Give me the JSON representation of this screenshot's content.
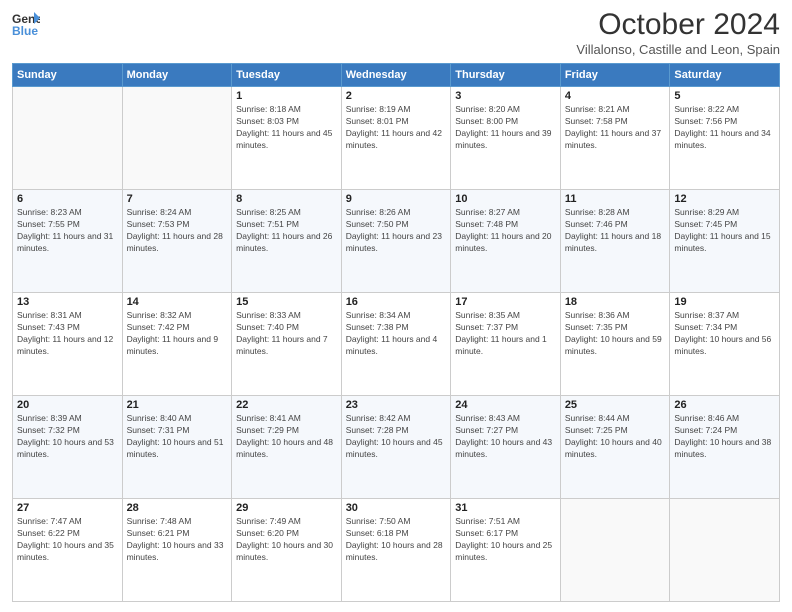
{
  "header": {
    "logo_line1": "General",
    "logo_line2": "Blue",
    "month_year": "October 2024",
    "location": "Villalonso, Castille and Leon, Spain"
  },
  "days_of_week": [
    "Sunday",
    "Monday",
    "Tuesday",
    "Wednesday",
    "Thursday",
    "Friday",
    "Saturday"
  ],
  "weeks": [
    [
      {
        "day": "",
        "sunrise": "",
        "sunset": "",
        "daylight": ""
      },
      {
        "day": "",
        "sunrise": "",
        "sunset": "",
        "daylight": ""
      },
      {
        "day": "1",
        "sunrise": "Sunrise: 8:18 AM",
        "sunset": "Sunset: 8:03 PM",
        "daylight": "Daylight: 11 hours and 45 minutes."
      },
      {
        "day": "2",
        "sunrise": "Sunrise: 8:19 AM",
        "sunset": "Sunset: 8:01 PM",
        "daylight": "Daylight: 11 hours and 42 minutes."
      },
      {
        "day": "3",
        "sunrise": "Sunrise: 8:20 AM",
        "sunset": "Sunset: 8:00 PM",
        "daylight": "Daylight: 11 hours and 39 minutes."
      },
      {
        "day": "4",
        "sunrise": "Sunrise: 8:21 AM",
        "sunset": "Sunset: 7:58 PM",
        "daylight": "Daylight: 11 hours and 37 minutes."
      },
      {
        "day": "5",
        "sunrise": "Sunrise: 8:22 AM",
        "sunset": "Sunset: 7:56 PM",
        "daylight": "Daylight: 11 hours and 34 minutes."
      }
    ],
    [
      {
        "day": "6",
        "sunrise": "Sunrise: 8:23 AM",
        "sunset": "Sunset: 7:55 PM",
        "daylight": "Daylight: 11 hours and 31 minutes."
      },
      {
        "day": "7",
        "sunrise": "Sunrise: 8:24 AM",
        "sunset": "Sunset: 7:53 PM",
        "daylight": "Daylight: 11 hours and 28 minutes."
      },
      {
        "day": "8",
        "sunrise": "Sunrise: 8:25 AM",
        "sunset": "Sunset: 7:51 PM",
        "daylight": "Daylight: 11 hours and 26 minutes."
      },
      {
        "day": "9",
        "sunrise": "Sunrise: 8:26 AM",
        "sunset": "Sunset: 7:50 PM",
        "daylight": "Daylight: 11 hours and 23 minutes."
      },
      {
        "day": "10",
        "sunrise": "Sunrise: 8:27 AM",
        "sunset": "Sunset: 7:48 PM",
        "daylight": "Daylight: 11 hours and 20 minutes."
      },
      {
        "day": "11",
        "sunrise": "Sunrise: 8:28 AM",
        "sunset": "Sunset: 7:46 PM",
        "daylight": "Daylight: 11 hours and 18 minutes."
      },
      {
        "day": "12",
        "sunrise": "Sunrise: 8:29 AM",
        "sunset": "Sunset: 7:45 PM",
        "daylight": "Daylight: 11 hours and 15 minutes."
      }
    ],
    [
      {
        "day": "13",
        "sunrise": "Sunrise: 8:31 AM",
        "sunset": "Sunset: 7:43 PM",
        "daylight": "Daylight: 11 hours and 12 minutes."
      },
      {
        "day": "14",
        "sunrise": "Sunrise: 8:32 AM",
        "sunset": "Sunset: 7:42 PM",
        "daylight": "Daylight: 11 hours and 9 minutes."
      },
      {
        "day": "15",
        "sunrise": "Sunrise: 8:33 AM",
        "sunset": "Sunset: 7:40 PM",
        "daylight": "Daylight: 11 hours and 7 minutes."
      },
      {
        "day": "16",
        "sunrise": "Sunrise: 8:34 AM",
        "sunset": "Sunset: 7:38 PM",
        "daylight": "Daylight: 11 hours and 4 minutes."
      },
      {
        "day": "17",
        "sunrise": "Sunrise: 8:35 AM",
        "sunset": "Sunset: 7:37 PM",
        "daylight": "Daylight: 11 hours and 1 minute."
      },
      {
        "day": "18",
        "sunrise": "Sunrise: 8:36 AM",
        "sunset": "Sunset: 7:35 PM",
        "daylight": "Daylight: 10 hours and 59 minutes."
      },
      {
        "day": "19",
        "sunrise": "Sunrise: 8:37 AM",
        "sunset": "Sunset: 7:34 PM",
        "daylight": "Daylight: 10 hours and 56 minutes."
      }
    ],
    [
      {
        "day": "20",
        "sunrise": "Sunrise: 8:39 AM",
        "sunset": "Sunset: 7:32 PM",
        "daylight": "Daylight: 10 hours and 53 minutes."
      },
      {
        "day": "21",
        "sunrise": "Sunrise: 8:40 AM",
        "sunset": "Sunset: 7:31 PM",
        "daylight": "Daylight: 10 hours and 51 minutes."
      },
      {
        "day": "22",
        "sunrise": "Sunrise: 8:41 AM",
        "sunset": "Sunset: 7:29 PM",
        "daylight": "Daylight: 10 hours and 48 minutes."
      },
      {
        "day": "23",
        "sunrise": "Sunrise: 8:42 AM",
        "sunset": "Sunset: 7:28 PM",
        "daylight": "Daylight: 10 hours and 45 minutes."
      },
      {
        "day": "24",
        "sunrise": "Sunrise: 8:43 AM",
        "sunset": "Sunset: 7:27 PM",
        "daylight": "Daylight: 10 hours and 43 minutes."
      },
      {
        "day": "25",
        "sunrise": "Sunrise: 8:44 AM",
        "sunset": "Sunset: 7:25 PM",
        "daylight": "Daylight: 10 hours and 40 minutes."
      },
      {
        "day": "26",
        "sunrise": "Sunrise: 8:46 AM",
        "sunset": "Sunset: 7:24 PM",
        "daylight": "Daylight: 10 hours and 38 minutes."
      }
    ],
    [
      {
        "day": "27",
        "sunrise": "Sunrise: 7:47 AM",
        "sunset": "Sunset: 6:22 PM",
        "daylight": "Daylight: 10 hours and 35 minutes."
      },
      {
        "day": "28",
        "sunrise": "Sunrise: 7:48 AM",
        "sunset": "Sunset: 6:21 PM",
        "daylight": "Daylight: 10 hours and 33 minutes."
      },
      {
        "day": "29",
        "sunrise": "Sunrise: 7:49 AM",
        "sunset": "Sunset: 6:20 PM",
        "daylight": "Daylight: 10 hours and 30 minutes."
      },
      {
        "day": "30",
        "sunrise": "Sunrise: 7:50 AM",
        "sunset": "Sunset: 6:18 PM",
        "daylight": "Daylight: 10 hours and 28 minutes."
      },
      {
        "day": "31",
        "sunrise": "Sunrise: 7:51 AM",
        "sunset": "Sunset: 6:17 PM",
        "daylight": "Daylight: 10 hours and 25 minutes."
      },
      {
        "day": "",
        "sunrise": "",
        "sunset": "",
        "daylight": ""
      },
      {
        "day": "",
        "sunrise": "",
        "sunset": "",
        "daylight": ""
      }
    ]
  ]
}
